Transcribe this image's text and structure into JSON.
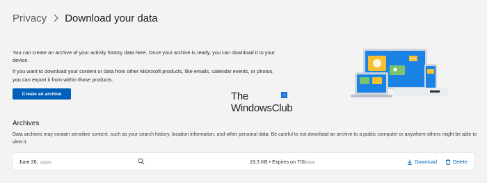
{
  "breadcrumb": {
    "parent": "Privacy",
    "current": "Download your data"
  },
  "intro": {
    "paragraph1": "You can create an archive of your activity history data here. Once your archive is ready, you can download it to your device.",
    "paragraph2": "If you want to download your content or data from other Microsoft products, like emails, calendar events, or photos, you can export it from within those products."
  },
  "create_button": {
    "label": "Create an archive"
  },
  "watermark": {
    "line1": "The",
    "line2": "WindowsClub"
  },
  "archives": {
    "heading": "Archives",
    "description": "Data archives may contain sensitive content, such as your search history, location information, and other personal data. Be careful to not download an archive to a public computer or anywhere others might be able to view it.",
    "rows": [
      {
        "date": "June 26,",
        "meta": "19.3 KB • Expires on 7/3/",
        "download_label": "Download",
        "delete_label": "Delete"
      }
    ]
  },
  "colors": {
    "accent": "#005fb8",
    "background": "#f3f3f3",
    "card": "#ffffff"
  },
  "icons": [
    "chevron-right-icon",
    "search-icon",
    "download-icon",
    "delete-icon",
    "windowsclub-logo-icon"
  ]
}
